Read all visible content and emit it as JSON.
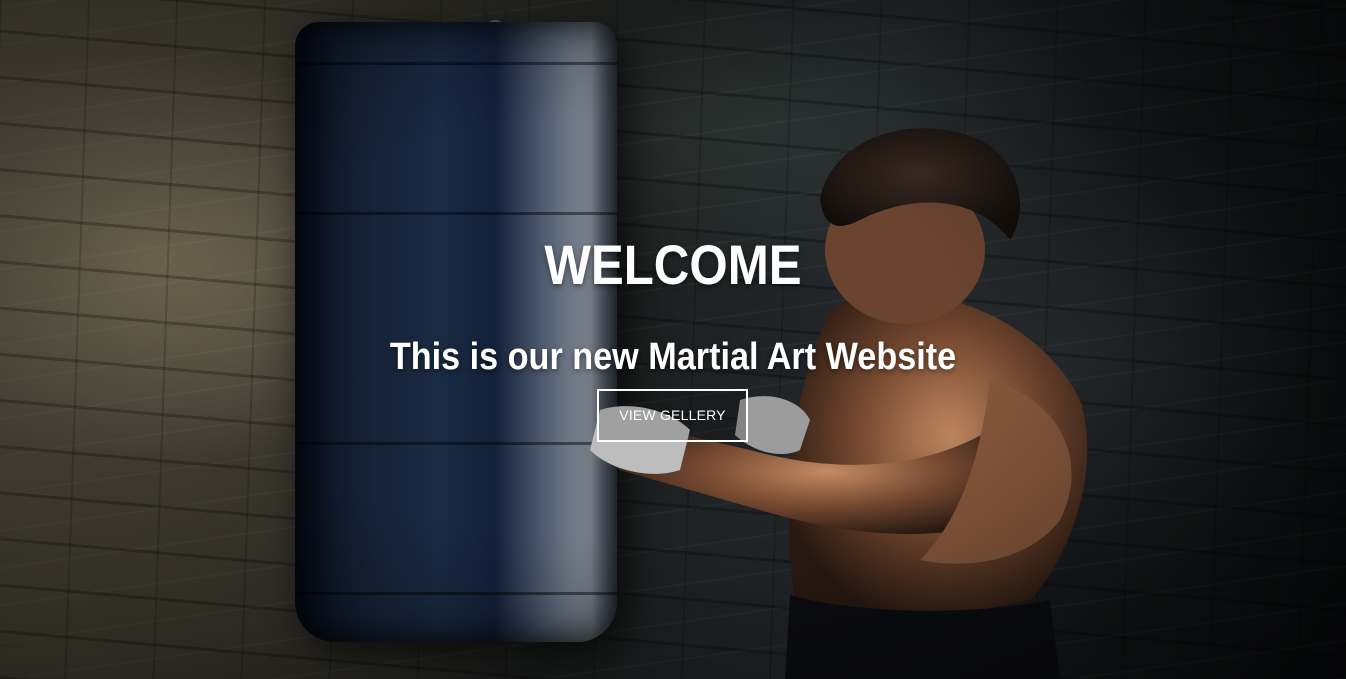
{
  "hero": {
    "heading": "WELCOME",
    "subheading": "This is our new Martial Art Website",
    "cta_label": "VIEW GELLERY",
    "text_color": "#ffffff"
  }
}
